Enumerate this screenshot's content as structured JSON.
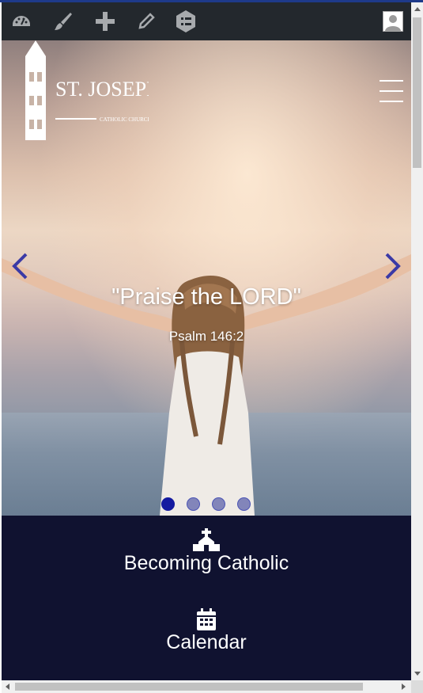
{
  "adminbar": {
    "icons": [
      "dashboard-icon",
      "customize-brush-icon",
      "add-new-icon",
      "edit-pencil-icon",
      "menu-list-icon"
    ],
    "avatar": "user-avatar-icon",
    "bg_color": "#23282d"
  },
  "logo": {
    "name_line1": "ST. JOSEPH",
    "name_line2": "CATHOLIC CHURCH"
  },
  "hero": {
    "quote": "\"Praise the LORD\"",
    "citation": "Psalm 146:2",
    "slides": 4,
    "active_slide": 1
  },
  "links": [
    {
      "label": "Becoming Catholic",
      "icon": "church-icon"
    },
    {
      "label": "Calendar",
      "icon": "calendar-icon"
    }
  ],
  "colors": {
    "links_bg": "#101230",
    "accent": "#141aa0",
    "text": "#ffffff"
  }
}
